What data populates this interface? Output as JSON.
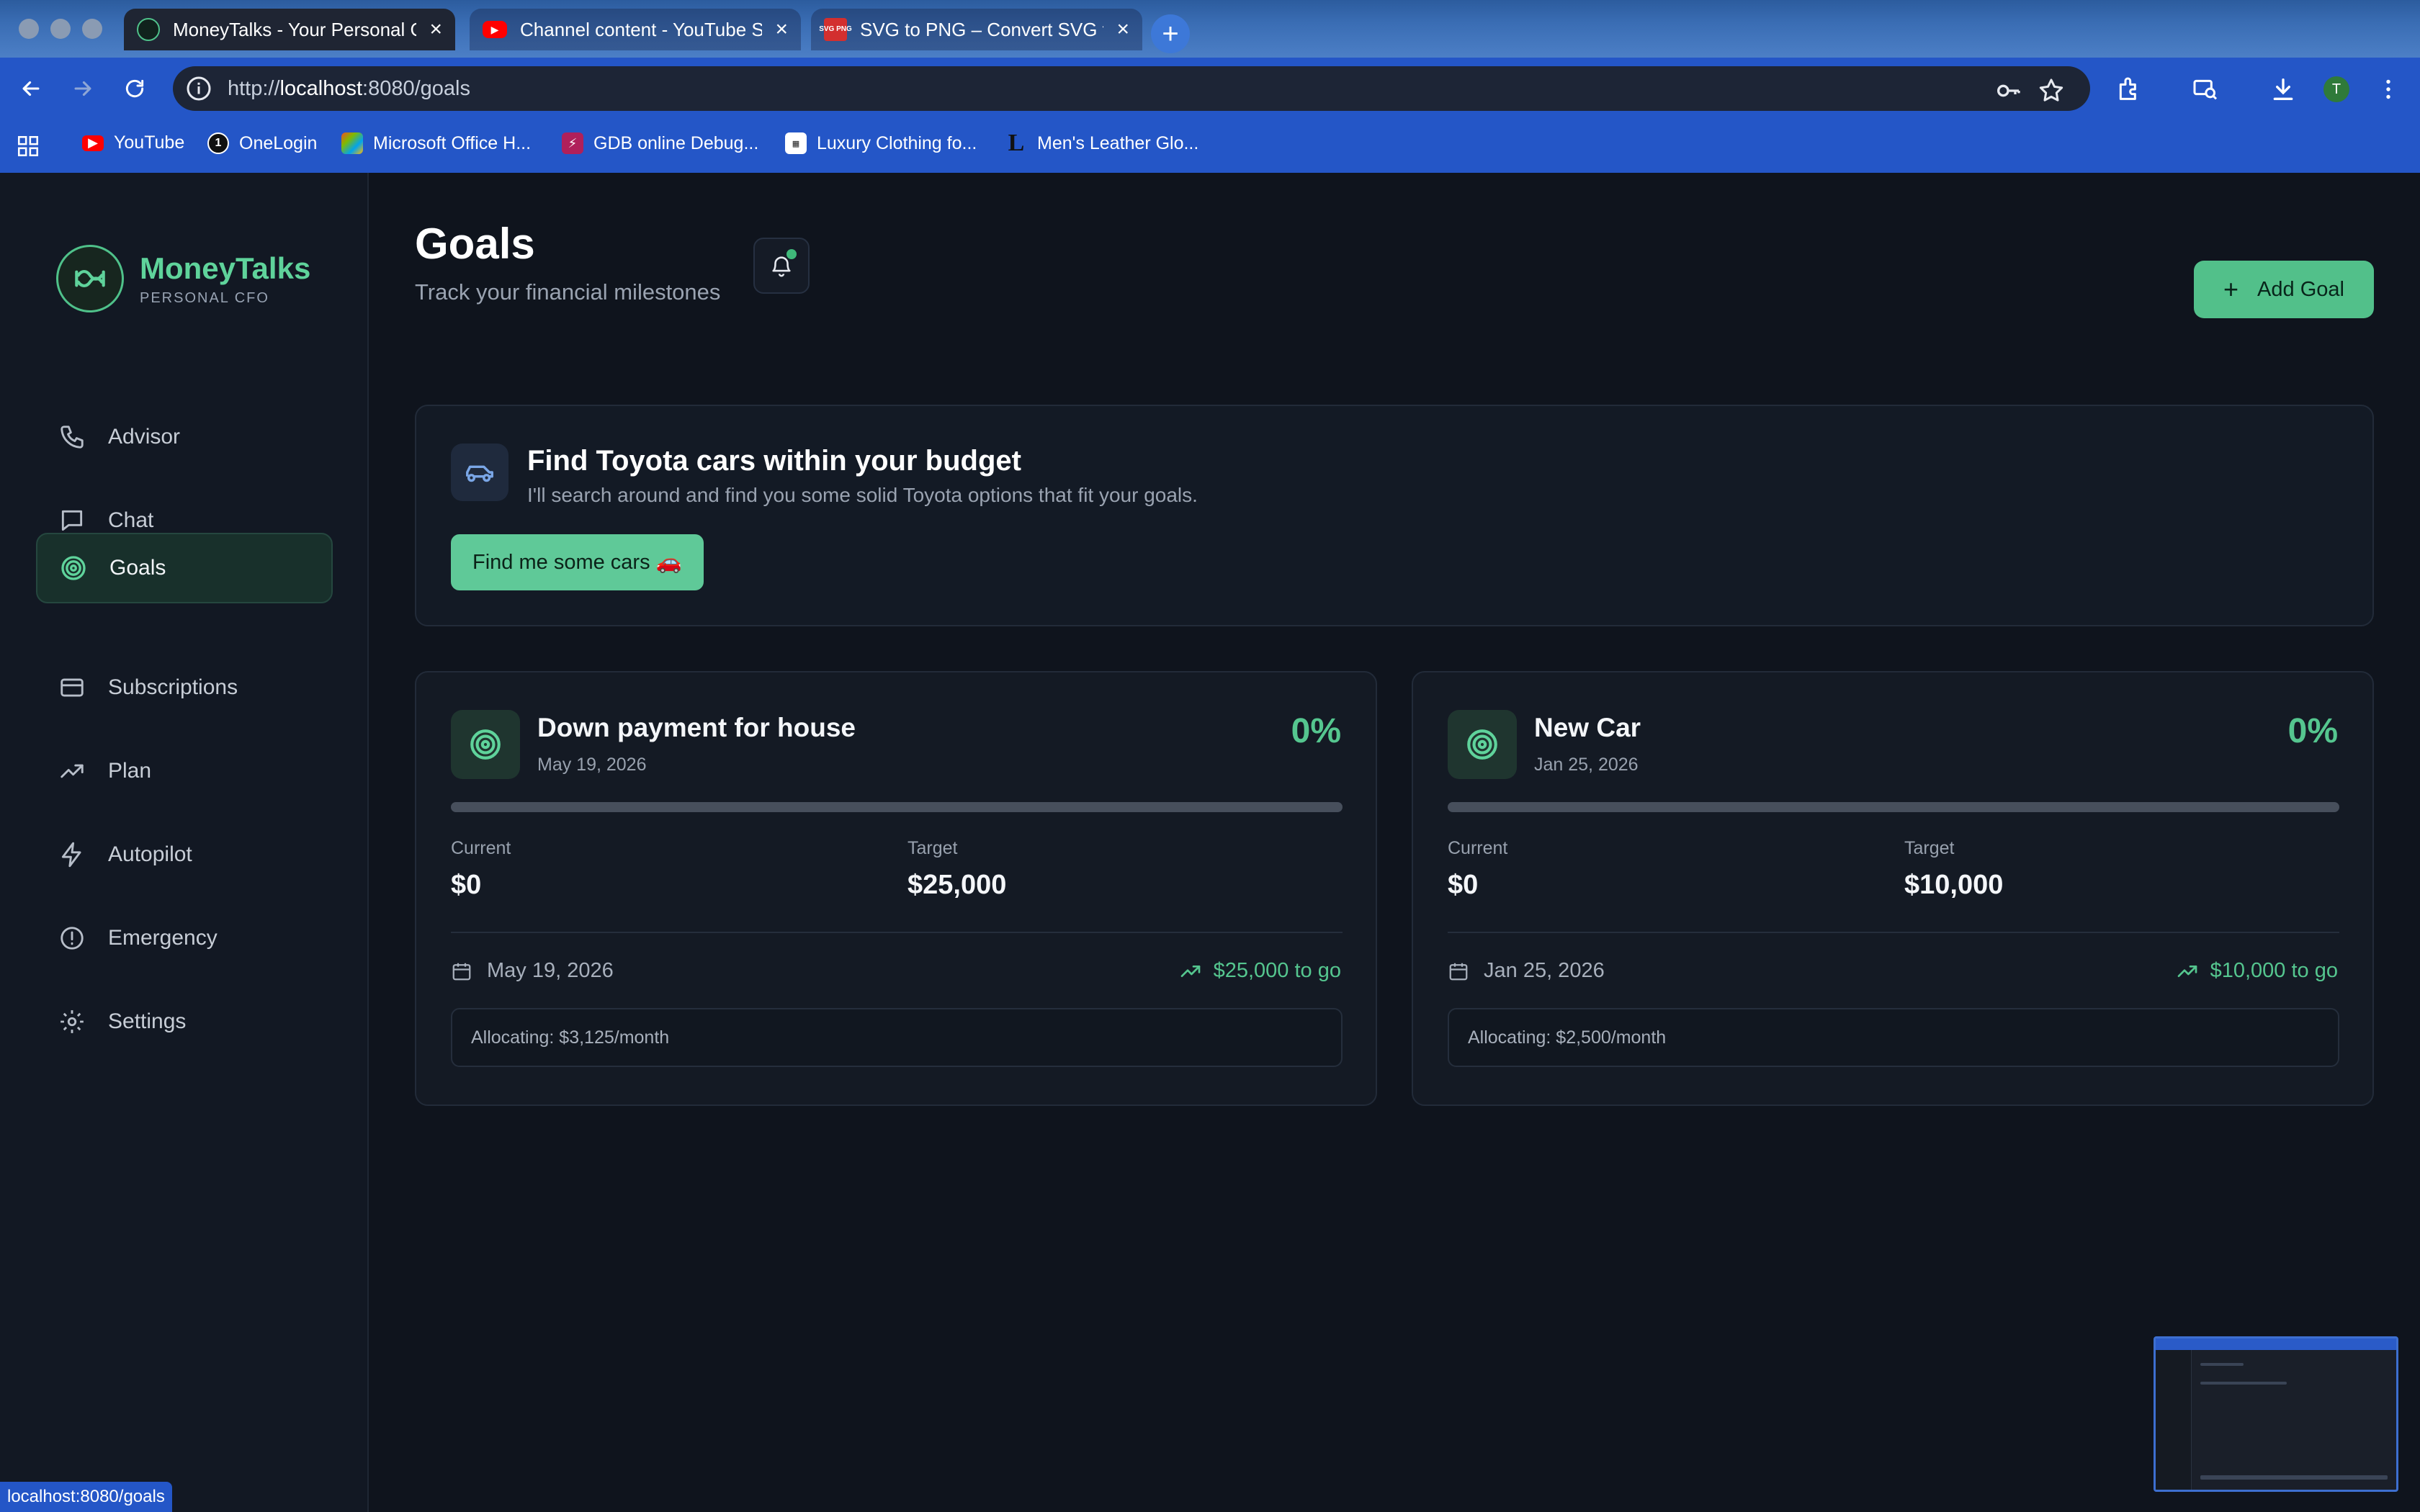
{
  "browser": {
    "tabs": [
      {
        "title": "MoneyTalks - Your Personal C",
        "active": true
      },
      {
        "title": "Channel content - YouTube St",
        "active": false
      },
      {
        "title": "SVG to PNG – Convert SVG fi",
        "active": false
      }
    ],
    "url_prefix": "http://",
    "url_host": "localhost",
    "url_rest": ":8080/goals",
    "bookmarks": [
      {
        "label": "YouTube",
        "icon": "youtube-icon",
        "color": "#ff0000"
      },
      {
        "label": "OneLogin",
        "icon": "onelogin-icon",
        "color": "#1a1a1a"
      },
      {
        "label": "Microsoft Office H...",
        "icon": "microsoft-office-icon",
        "color": "#d04a8a"
      },
      {
        "label": "GDB online Debug...",
        "icon": "gdb-icon",
        "color": "#b0205a"
      },
      {
        "label": "Luxury Clothing fo...",
        "icon": "luxury-clothing-icon",
        "color": "#ffffff"
      },
      {
        "label": "Men's Leather Glo...",
        "icon": "leather-gloves-icon",
        "color": "#111111"
      }
    ],
    "status_url": "localhost:8080/goals",
    "profile_initial": "T",
    "svg_fav_text": "SVG PNG"
  },
  "sidebar": {
    "brand_name": "MoneyTalks",
    "brand_sub": "PERSONAL CFO",
    "items": [
      {
        "label": "Advisor",
        "icon": "phone-icon"
      },
      {
        "label": "Chat",
        "icon": "chat-bubble-icon"
      },
      {
        "label": "Goals",
        "icon": "target-icon",
        "active": true
      },
      {
        "label": "Subscriptions",
        "icon": "credit-card-icon"
      },
      {
        "label": "Plan",
        "icon": "trending-up-icon"
      },
      {
        "label": "Autopilot",
        "icon": "lightning-icon"
      },
      {
        "label": "Emergency",
        "icon": "alert-circle-icon"
      },
      {
        "label": "Settings",
        "icon": "gear-icon"
      }
    ]
  },
  "header": {
    "title": "Goals",
    "subtitle": "Track your financial milestones",
    "add_goal_label": "Add Goal"
  },
  "promo": {
    "title": "Find Toyota cars within your budget",
    "description": "I'll search around and find you some solid Toyota options that fit your goals.",
    "button_label": "Find me some cars 🚗"
  },
  "goals": [
    {
      "name": "Down payment for house",
      "date": "May 19, 2026",
      "percent_label": "0%",
      "progress": 0,
      "current_label": "Current",
      "current": "$0",
      "target_label": "Target",
      "target": "$25,000",
      "to_go": "$25,000 to go",
      "allocating": "Allocating: $3,125/month"
    },
    {
      "name": "New Car",
      "date": "Jan 25, 2026",
      "percent_label": "0%",
      "progress": 0,
      "current_label": "Current",
      "current": "$0",
      "target_label": "Target",
      "target": "$10,000",
      "to_go": "$10,000 to go",
      "allocating": "Allocating: $2,500/month"
    }
  ],
  "colors": {
    "accent": "#55c68f",
    "background": "#0f141d",
    "browser_blue": "#2456c7"
  }
}
